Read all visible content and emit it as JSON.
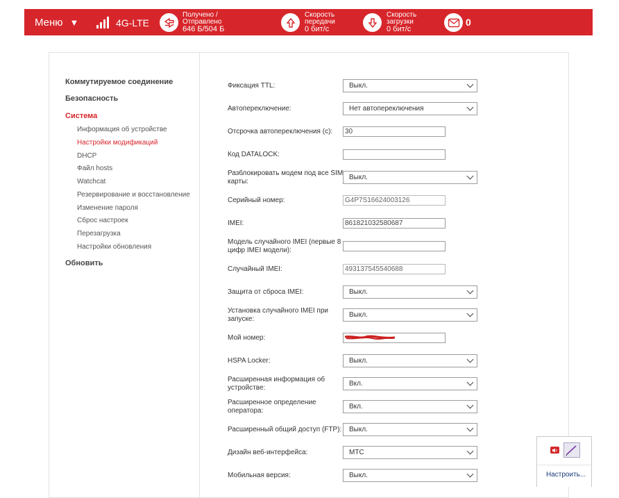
{
  "header": {
    "menu_label": "Меню",
    "network_type": "4G-LTE",
    "traffic_label_1": "Получено /",
    "traffic_label_2": "Отправлено",
    "traffic_value": "646 Б/504 Б",
    "upload_label_1": "Скорость",
    "upload_label_2": "передачи",
    "upload_value": "0 бит/с",
    "download_label_1": "Скорость",
    "download_label_2": "загрузки",
    "download_value": "0 бит/с",
    "messages_count": "0",
    "accent_color": "#d7262b"
  },
  "sidebar": {
    "groups": [
      {
        "label": "Коммутируемое соединение"
      },
      {
        "label": "Безопасность"
      },
      {
        "label": "Система"
      },
      {
        "label": "Обновить"
      }
    ],
    "system_items": [
      {
        "label": "Информация об устройстве"
      },
      {
        "label": "Настройки модификаций"
      },
      {
        "label": "DHCP"
      },
      {
        "label": "Файл hosts"
      },
      {
        "label": "Watchcat"
      },
      {
        "label": "Резервирование и восстановление"
      },
      {
        "label": "Изменение пароля"
      },
      {
        "label": "Сброс настроек"
      },
      {
        "label": "Перезагрузка"
      },
      {
        "label": "Настройки обновления"
      }
    ]
  },
  "form": {
    "fields": [
      {
        "label": "Фиксация TTL:",
        "value": "Выкл."
      },
      {
        "label": "Автопереключение:",
        "value": "Нет автопереключения"
      },
      {
        "label": "Отсрочка автопереключения (с):",
        "value": "30"
      },
      {
        "label": "Код DATALOCK:",
        "value": ""
      },
      {
        "label": "Разблокировать модем под все SIM-карты:",
        "value": "Выкл."
      },
      {
        "label": "Серийный номер:",
        "value": "G4P7S16624003126"
      },
      {
        "label": "IMEI:",
        "value": "861821032580687"
      },
      {
        "label": "Модель случайного IMEI (первые 8 цифр IMEI модели):",
        "value": ""
      },
      {
        "label": "Случайный IMEI:",
        "value": "493137545540688"
      },
      {
        "label": "Защита от сброса IMEI:",
        "value": "Выкл."
      },
      {
        "label": "Установка случайного IMEI при запуске:",
        "value": "Выкл."
      },
      {
        "label": "Мой номер:",
        "value": ""
      },
      {
        "label": "HSPA Locker:",
        "value": "Выкл."
      },
      {
        "label": "Расширенная информация об устройстве:",
        "value": "Вкл."
      },
      {
        "label": "Расширенное определение оператора:",
        "value": "Вкл."
      },
      {
        "label": "Расширенный общий доступ (FTP):",
        "value": "Выкл."
      },
      {
        "label": "Дизайн веб-интерфейса:",
        "value": "МТС"
      },
      {
        "label": "Мобильная версия:",
        "value": "Выкл."
      }
    ]
  },
  "tray": {
    "link_label": "Настроить..."
  }
}
